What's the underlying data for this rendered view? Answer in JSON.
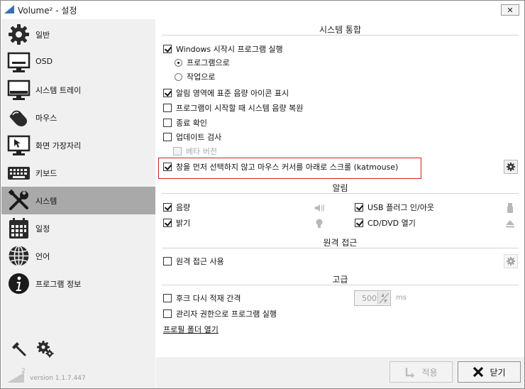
{
  "window": {
    "title": "Volume² - 설정",
    "close_glyph": "✕"
  },
  "sidebar": {
    "items": [
      {
        "label": "일반",
        "icon": "gear-icon"
      },
      {
        "label": "OSD",
        "icon": "monitor-icon"
      },
      {
        "label": "시스템 트레이",
        "icon": "tray-monitor-icon"
      },
      {
        "label": "마우스",
        "icon": "mouse-icon"
      },
      {
        "label": "화면 가장자리",
        "icon": "screen-edge-icon"
      },
      {
        "label": "키보드",
        "icon": "keyboard-icon"
      },
      {
        "label": "시스템",
        "icon": "wrench-screwdriver-icon"
      },
      {
        "label": "일정",
        "icon": "calendar-icon"
      },
      {
        "label": "언어",
        "icon": "globe-icon"
      },
      {
        "label": "프로그램 정보",
        "icon": "info-icon"
      }
    ],
    "active_index": 6,
    "version_badge": "2",
    "version": "version 1.1.7.447"
  },
  "system_integration": {
    "title": "시스템 통합",
    "start_with_windows": "Windows 시작시 프로그램 실행",
    "as_program": "프로그램으로",
    "as_task": "작업으로",
    "show_tray_icon": "알림 영역에 표준 음량 아이콘 표시",
    "restore_volume": "프로그램이 시작할 때 시스템 음량 복원",
    "confirm_exit": "종료 확인",
    "check_updates": "업데이트 검사",
    "beta_version": "베타 버전",
    "katmouse": "창을 먼저 선택하지 않고 마우스 커서를 아래로 스크롤 (katmouse)"
  },
  "notifications": {
    "title": "알림",
    "volume": "음량",
    "brightness": "밝기",
    "usb": "USB 플러그 인/아웃",
    "cddvd": "CD/DVD 열기"
  },
  "remote": {
    "title": "원격 접근",
    "use_remote": "원격 접근 사용"
  },
  "advanced": {
    "title": "고급",
    "hook_interval": "후크 다시 적재 간격",
    "interval_value": "500",
    "interval_unit": "ms",
    "run_as_admin": "관리자 권한으로 프로그램 실행",
    "open_profile_folder": "프로필 폴더 열기"
  },
  "footer": {
    "apply_label": "적용",
    "close_label": "닫기"
  },
  "colors": {
    "active_nav": "#a9a9a9",
    "highlight": "#d22020"
  }
}
